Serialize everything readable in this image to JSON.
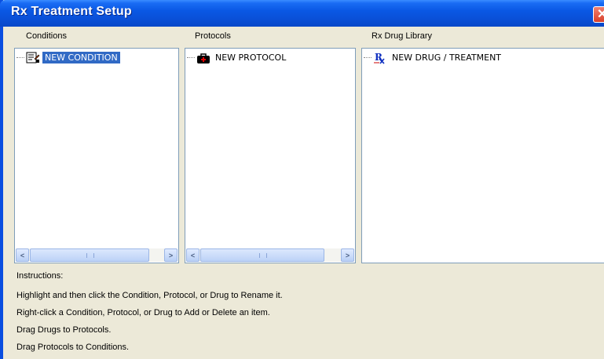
{
  "window": {
    "title": "Rx Treatment Setup"
  },
  "columns": {
    "conditions": {
      "label": "Conditions",
      "item": "NEW CONDITION"
    },
    "protocols": {
      "label": "Protocols",
      "item": "NEW PROTOCOL"
    },
    "drugs": {
      "label": "Rx Drug Library",
      "item": "NEW DRUG / TREATMENT"
    }
  },
  "scrollbar": {
    "left_arrow": "<",
    "right_arrow": ">"
  },
  "instructions": {
    "heading": "Instructions:",
    "lines": [
      "Highlight and then click the Condition, Protocol, or Drug to Rename it.",
      "Right-click a Condition, Protocol, or Drug to Add or Delete an item.",
      "Drag Drugs to Protocols.",
      "Drag Protocols to Conditions."
    ]
  },
  "icons": {
    "condition": "condition-icon",
    "protocol": "medical-bag-icon",
    "drug": "rx-icon",
    "close": "close-icon"
  },
  "colors": {
    "titlebar": "#0a58e4",
    "selection": "#316ac5",
    "window_bg": "#ece9d8"
  }
}
